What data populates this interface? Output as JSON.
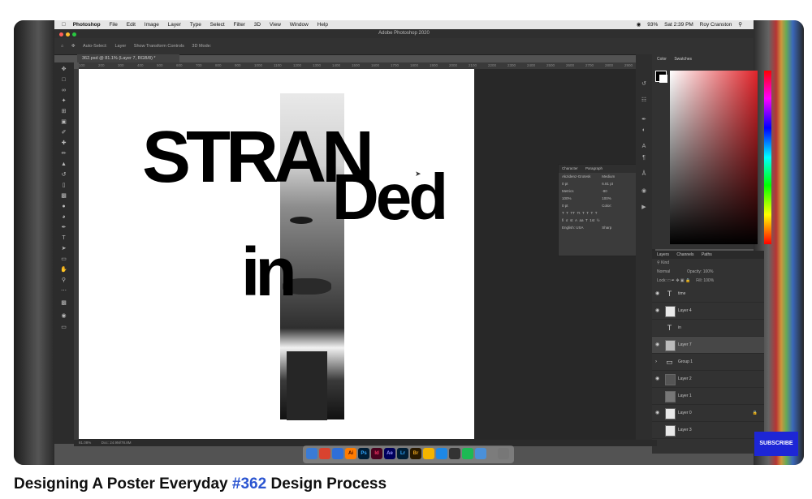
{
  "macos_menubar": {
    "app": "Photoshop",
    "menus": [
      "File",
      "Edit",
      "Image",
      "Layer",
      "Type",
      "Select",
      "Filter",
      "3D",
      "View",
      "Window",
      "Help"
    ],
    "battery": "93%",
    "clock": "Sat 2:39 PM",
    "user": "Roy Cranston"
  },
  "window_title": "Adobe Photoshop 2020",
  "options_bar": {
    "auto_select": "Auto-Select:",
    "auto_select_value": "Layer",
    "transform_controls": "Show Transform Controls",
    "mode_3d": "3D Mode:"
  },
  "document_tab": "362.psd @ 81.1% (Layer 7, RGB/8) *",
  "ruler_ticks": [
    "100",
    "200",
    "300",
    "400",
    "500",
    "600",
    "700",
    "800",
    "900",
    "1000",
    "1100",
    "1200",
    "1300",
    "1400",
    "1500",
    "1600",
    "1700",
    "1800",
    "1900",
    "2000",
    "2100",
    "2200",
    "2300",
    "2400",
    "2500",
    "2600",
    "2700",
    "2800",
    "2900",
    "3000",
    "3100",
    "3200",
    "3300"
  ],
  "artwork": {
    "word1": "STRAN",
    "word2": "Ded",
    "word3": "in"
  },
  "character_panel": {
    "tabs": [
      "Character",
      "Paragraph"
    ],
    "font_family": "Akzidenz-Grotesk",
    "font_style": "Medium",
    "font_size": "0 pt",
    "leading": "6.81 pt",
    "kerning": "Metrics",
    "tracking": "-80",
    "vertical_scale": "100%",
    "horizontal_scale": "100%",
    "baseline_shift": "0 pt",
    "color_label": "Color:",
    "language": "English: USA",
    "antialias": "Sharp"
  },
  "color_panel": {
    "tabs": [
      "Color",
      "Swatches"
    ],
    "foreground_color": "#000000",
    "background_color": "#ffffff",
    "picker_hue": "#e0242a"
  },
  "layers_panel": {
    "tabs": [
      "Layers",
      "Channels",
      "Paths"
    ],
    "filter_kind": "Kind",
    "blend_mode": "Normal",
    "opacity_label": "Opacity:",
    "opacity": "100%",
    "lock_label": "Lock:",
    "fill_label": "Fill:",
    "fill": "100%",
    "layers": [
      {
        "name": "time",
        "type": "text"
      },
      {
        "name": "Layer 4",
        "type": "pixel"
      },
      {
        "name": "in",
        "type": "text"
      },
      {
        "name": "Layer 7",
        "type": "pixel",
        "selected": true
      },
      {
        "name": "Group 1",
        "type": "group"
      },
      {
        "name": "Layer 2",
        "type": "pixel"
      },
      {
        "name": "Layer 1",
        "type": "pixel"
      },
      {
        "name": "Layer 0",
        "type": "pixel"
      },
      {
        "name": "Layer 3",
        "type": "pixel"
      }
    ]
  },
  "status_bar": {
    "zoom": "81.08%",
    "doc_size": "Doc: 24.9M/78.8M"
  },
  "dock_apps": [
    "Ai",
    "Ps",
    "Id",
    "Ae",
    "Lr",
    "Br"
  ],
  "subscribe_label": "SUBSCRIBE",
  "video_title": {
    "prefix": "Designing A Poster Everyday ",
    "hashtag": "#362",
    "suffix": " Design Process"
  }
}
